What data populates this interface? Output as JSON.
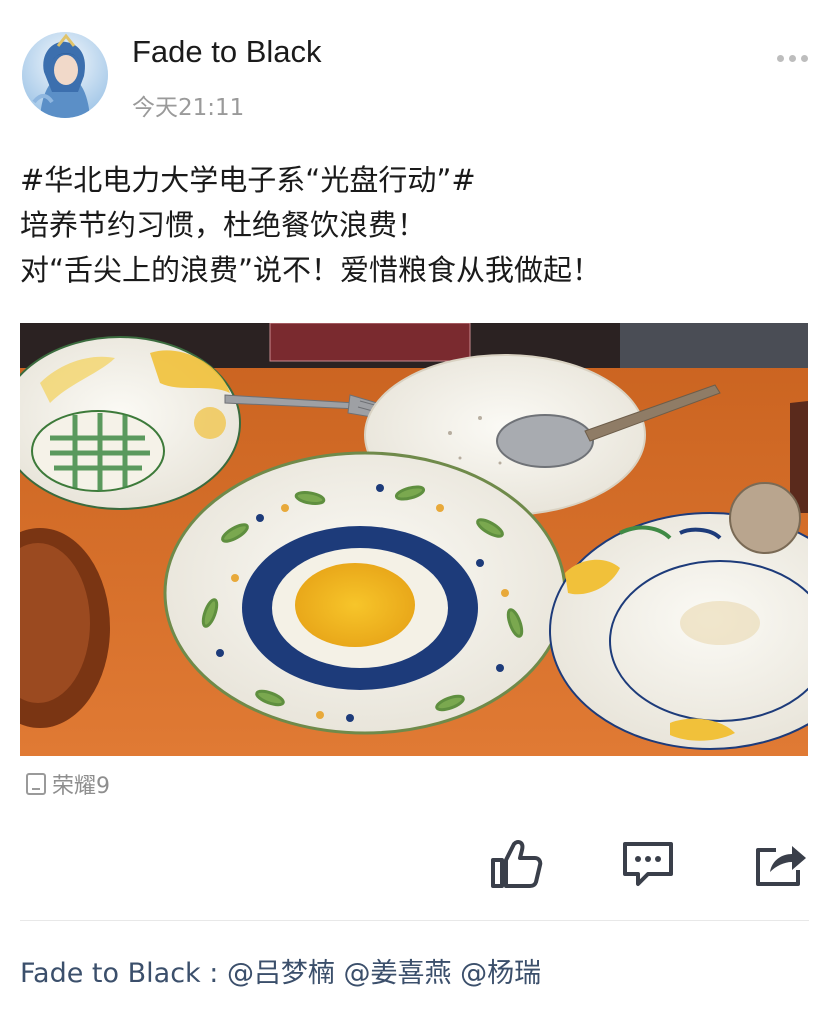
{
  "post": {
    "username": "Fade to Black",
    "time": "今天21:11",
    "text_lines": [
      "#华北电力大学电子系“光盘行动”#",
      "培养节约习惯，杜绝餐饮浪费！",
      "对“舌尖上的浪费”说不！爱惜粮食从我做起！"
    ],
    "device": "荣耀9"
  },
  "icons": {
    "more": "more-dots-icon",
    "device": "phone-icon",
    "like": "thumbs-up-icon",
    "comment": "comment-bubble-icon",
    "share": "share-arrow-icon"
  },
  "comment": {
    "author": "Fade to Black",
    "separator": " : ",
    "mentions": [
      "@吕梦楠",
      "@姜喜燕",
      "@杨瑞"
    ]
  },
  "colors": {
    "username": "#1b1b1b",
    "meta_gray": "#9a9a9a",
    "comment_blue": "#3b4f6b",
    "icon_dark": "#3a3f4a",
    "table_orange": "#d7712d"
  }
}
